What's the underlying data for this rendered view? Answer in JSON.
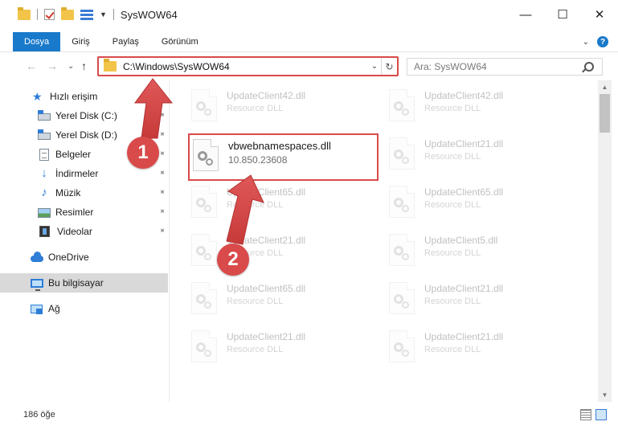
{
  "window": {
    "title": "SysWOW64",
    "minimize": "—",
    "maximize": "☐",
    "close": "✕"
  },
  "ribbon": {
    "tabs": [
      "Dosya",
      "Giriş",
      "Paylaş",
      "Görünüm"
    ],
    "expand": "⌄",
    "help": "?"
  },
  "nav": {
    "back": "←",
    "forward": "→",
    "recent": "⌄",
    "up": "↑",
    "address": "C:\\Windows\\SysWOW64",
    "address_dropdown": "⌄",
    "refresh": "↻",
    "search_placeholder": "Ara: SysWOW64"
  },
  "sidebar": {
    "items": [
      {
        "label": "Hızlı erişim",
        "icon": "star-icon"
      },
      {
        "label": "Yerel Disk (C:)",
        "icon": "drive-icon",
        "pinned": true
      },
      {
        "label": "Yerel Disk (D:)",
        "icon": "drive-icon",
        "pinned": true
      },
      {
        "label": "Belgeler",
        "icon": "documents-icon",
        "pinned": true
      },
      {
        "label": "İndirmeler",
        "icon": "downloads-icon",
        "pinned": true
      },
      {
        "label": "Müzik",
        "icon": "music-icon",
        "pinned": true
      },
      {
        "label": "Resimler",
        "icon": "pictures-icon",
        "pinned": true
      },
      {
        "label": "Videolar",
        "icon": "videos-icon",
        "pinned": true
      },
      {
        "label": "OneDrive",
        "icon": "onedrive-icon"
      },
      {
        "label": "Bu bilgisayar",
        "icon": "this-pc-icon",
        "selected": true
      },
      {
        "label": "Ağ",
        "icon": "network-icon"
      }
    ],
    "pin_glyph": "📌"
  },
  "highlighted_file": {
    "name": "vbwebnamespaces.dll",
    "version": "10.850.23608"
  },
  "files": [
    {
      "name": "UpdateClient42.dll",
      "desc": "Resource DLL"
    },
    {
      "name": "UpdateClient42.dll",
      "desc": "Resource DLL"
    },
    {
      "name": "UpdateClient21.dll",
      "desc": "Resource DLL"
    },
    {
      "name": "UpdateClient65.dll",
      "desc": "Resource DLL"
    },
    {
      "name": "UpdateClient65.dll",
      "desc": "Resource DLL"
    },
    {
      "name": "UpdateClient21.dll",
      "desc": "Resource DLL"
    },
    {
      "name": "UpdateClient5.dll",
      "desc": "Resource DLL"
    },
    {
      "name": "UpdateClient65.dll",
      "desc": "Resource DLL"
    },
    {
      "name": "UpdateClient21.dll",
      "desc": "Resource DLL"
    },
    {
      "name": "UpdateClient21.dll",
      "desc": "Resource DLL"
    },
    {
      "name": "UpdateClient21.dll",
      "desc": "Resource DLL"
    }
  ],
  "scrollbar": {
    "up": "▲",
    "down": "▼"
  },
  "status": {
    "item_count": "186 öğe"
  },
  "annotations": {
    "step1": "1",
    "step2": "2",
    "color": "#d94a4a"
  }
}
